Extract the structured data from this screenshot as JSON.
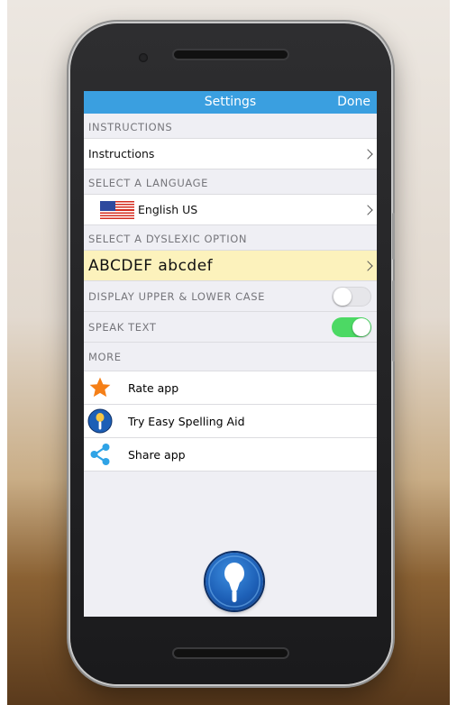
{
  "navbar": {
    "title": "Settings",
    "done_label": "Done"
  },
  "sections": {
    "instructions": "INSTRUCTIONS",
    "language": "SELECT A LANGUAGE",
    "dyslexic": "SELECT A DYSLEXIC OPTION",
    "more": "MORE"
  },
  "instructions_row": {
    "label": "Instructions"
  },
  "language_row": {
    "label": "English US",
    "flag_icon": "us-flag-icon"
  },
  "dyslexic_row": {
    "label": "ABCDEF abcdef",
    "highlight_color": "#fcf2bc"
  },
  "toggles": {
    "upper_lower": {
      "label": "DISPLAY UPPER & LOWER CASE",
      "state": "off"
    },
    "speak_text": {
      "label": "SPEAK TEXT",
      "state": "on"
    }
  },
  "more_items": [
    {
      "label": "Rate app",
      "icon": "star-icon"
    },
    {
      "label": "Try Easy Spelling Aid",
      "icon": "microphone-icon"
    },
    {
      "label": "Share app",
      "icon": "share-icon"
    }
  ],
  "colors": {
    "navbar": "#3a9fe0",
    "toggle_on": "#4cd964",
    "star": "#f57f17",
    "share": "#2fa3e6",
    "mic_blue": "#1d5fb6"
  }
}
